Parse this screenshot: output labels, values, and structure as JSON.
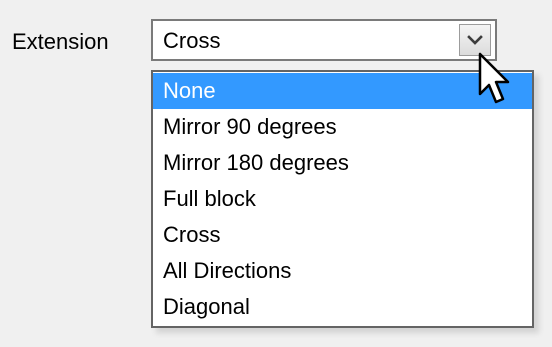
{
  "extension": {
    "label": "Extension",
    "selected_value": "Cross",
    "highlighted_option": "None",
    "options": [
      "None",
      "Mirror 90 degrees",
      "Mirror 180 degrees",
      "Full block",
      "Cross",
      "All Directions",
      "Diagonal"
    ]
  },
  "icons": {
    "dropdown_arrow": "chevron-down-icon",
    "pointer": "mouse-cursor-icon"
  },
  "colors": {
    "background": "#f0f0f0",
    "highlight": "#3399ff",
    "highlight_text": "#ffffff"
  }
}
